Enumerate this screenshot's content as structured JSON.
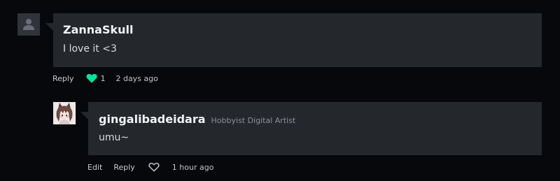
{
  "comments": [
    {
      "username": "ZannaSkull",
      "body": "I love it <3",
      "actions": {
        "reply_label": "Reply",
        "like_icon": "heart-filled-icon",
        "like_count": "1",
        "timestamp": "2 days ago"
      }
    },
    {
      "username": "gingalibadeidara",
      "user_title": "Hobbyist Digital Artist",
      "body": "umu~",
      "actions": {
        "edit_label": "Edit",
        "reply_label": "Reply",
        "like_icon": "heart-outline-icon",
        "timestamp": "1 hour ago"
      }
    }
  ],
  "colors": {
    "background": "#07080c",
    "bubble": "#24272c",
    "like_active": "#00e59b",
    "username": "#f2f3f5",
    "muted": "#8c9198"
  }
}
